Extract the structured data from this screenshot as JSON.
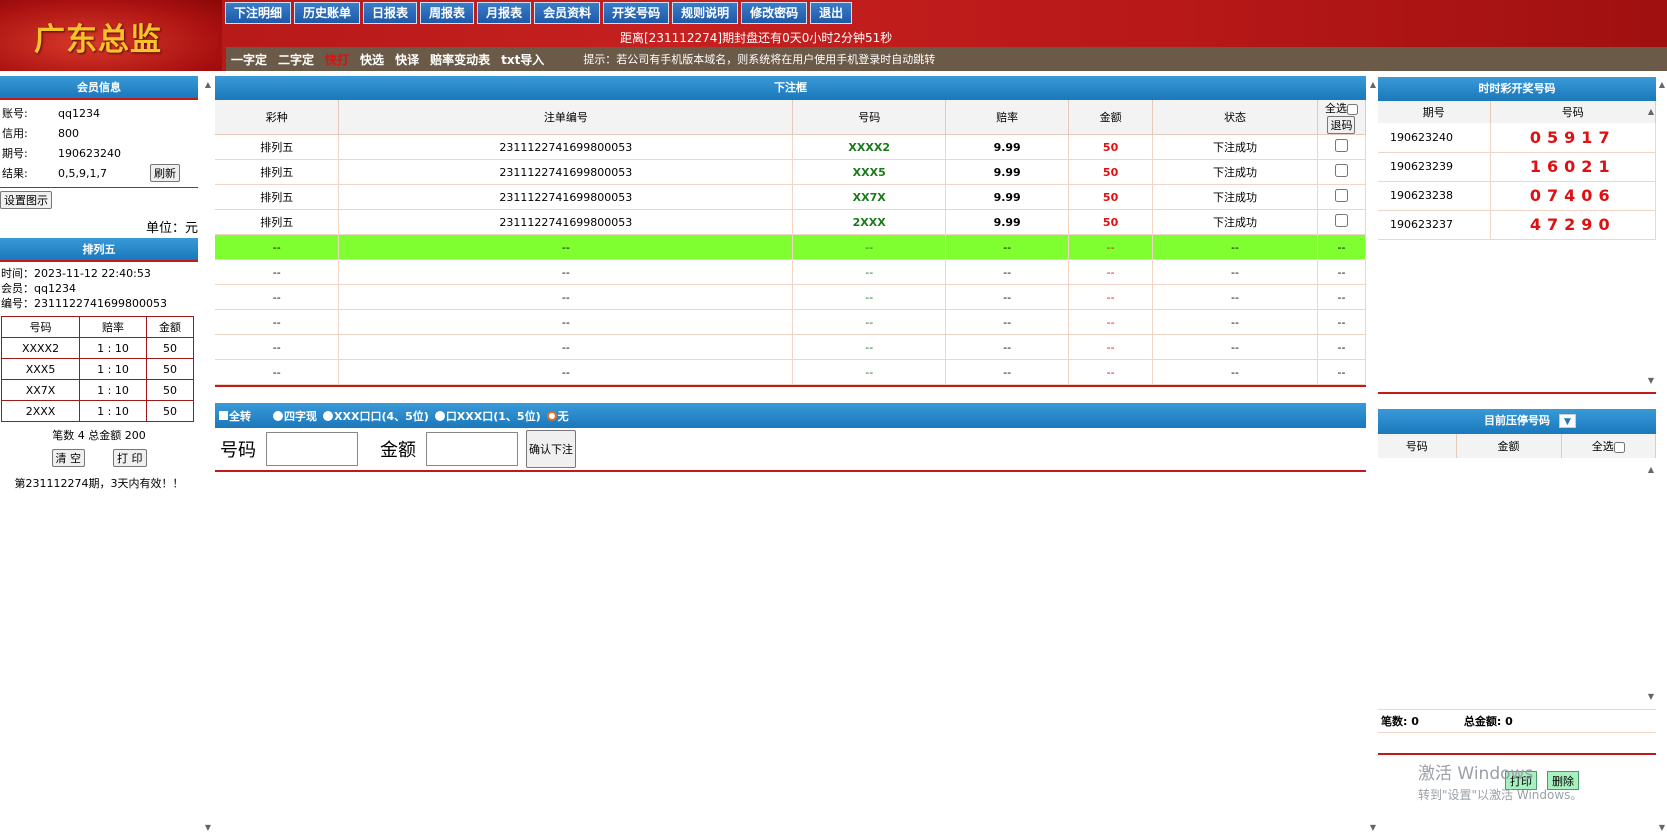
{
  "header": {
    "logo": "广东总监",
    "nav": [
      "下注明细",
      "历史账单",
      "日报表",
      "周报表",
      "月报表",
      "会员资料",
      "开奖号码",
      "规则说明",
      "修改密码",
      "退出"
    ],
    "countdown": "距离[231112274]期封盘还有0天0小时2分钟51秒",
    "subnav": [
      "一字定",
      "二字定",
      "快打",
      "快选",
      "快译",
      "赔率变动表",
      "txt导入"
    ],
    "hint": "提示：若公司有手机版本域名，则系统将在用户使用手机登录时自动跳转"
  },
  "member": {
    "title": "会员信息",
    "account_label": "账号:",
    "account": "qq1234",
    "credit_label": "信用:",
    "credit": "800",
    "period_label": "期号:",
    "period": "190623240",
    "result_label": "结果:",
    "result": "0,5,9,1,7",
    "refresh": "刷新",
    "settings": "设置图示",
    "unit": "单位：元"
  },
  "pl5": {
    "title": "排列五",
    "time": "时间：2023-11-12 22:40:53",
    "member": "会员：qq1234",
    "serial": "编号：2311122741699800053",
    "headers": [
      "号码",
      "赔率",
      "金额"
    ],
    "rows": [
      [
        "XXXX2",
        "1 : 10",
        "50"
      ],
      [
        "XXX5",
        "1 : 10",
        "50"
      ],
      [
        "XX7X",
        "1 : 10",
        "50"
      ],
      [
        "2XXX",
        "1 : 10",
        "50"
      ]
    ],
    "summary": "笔数 4 总金额 200",
    "clear": "清 空",
    "print": "打 印",
    "valid": "第231112274期，3天内有效！！"
  },
  "bets": {
    "title": "下注框",
    "headers": [
      "彩种",
      "注单编号",
      "号码",
      "赔率",
      "金额",
      "状态",
      "全选"
    ],
    "retract": "退码",
    "rows": [
      [
        "排列五",
        "2311122741699800053",
        "XXXX2",
        "9.99",
        "50",
        "下注成功"
      ],
      [
        "排列五",
        "2311122741699800053",
        "XXX5",
        "9.99",
        "50",
        "下注成功"
      ],
      [
        "排列五",
        "2311122741699800053",
        "XX7X",
        "9.99",
        "50",
        "下注成功"
      ],
      [
        "排列五",
        "2311122741699800053",
        "2XXX",
        "9.99",
        "50",
        "下注成功"
      ]
    ],
    "empty_rows": [
      [
        "--",
        "--",
        "--",
        "--",
        "--",
        "--",
        "--"
      ],
      [
        "--",
        "--",
        "--",
        "--",
        "--",
        "--",
        "--"
      ],
      [
        "--",
        "--",
        "--",
        "--",
        "--",
        "--",
        "--"
      ],
      [
        "--",
        "--",
        "--",
        "--",
        "--",
        "--",
        "--"
      ],
      [
        "--",
        "--",
        "--",
        "--",
        "--",
        "--",
        "--"
      ],
      [
        "--",
        "--",
        "--",
        "--",
        "--",
        "--",
        "--"
      ]
    ]
  },
  "options": {
    "all": "全转",
    "items": [
      "四字现",
      "XXX口口(4、5位)",
      "口XXX口(1、5位)",
      "无"
    ]
  },
  "entry": {
    "number_label": "号码",
    "amount_label": "金额",
    "confirm": "确认下注"
  },
  "draw": {
    "title": "时时彩开奖号码",
    "headers": [
      "期号",
      "号码"
    ],
    "rows": [
      [
        "190623240",
        "05917"
      ],
      [
        "190623239",
        "16021"
      ],
      [
        "190623238",
        "07406"
      ],
      [
        "190623237",
        "47290"
      ]
    ]
  },
  "press": {
    "title": "目前压停号码",
    "headers": [
      "号码",
      "金额",
      "全选"
    ],
    "count_label": "笔数:",
    "count": "0",
    "total_label": "总金额:",
    "total": "0",
    "print": "打印",
    "delete": "删除"
  },
  "watermark": {
    "line1": "激活 Windows",
    "line2": "转到\"设置\"以激活 Windows。"
  }
}
